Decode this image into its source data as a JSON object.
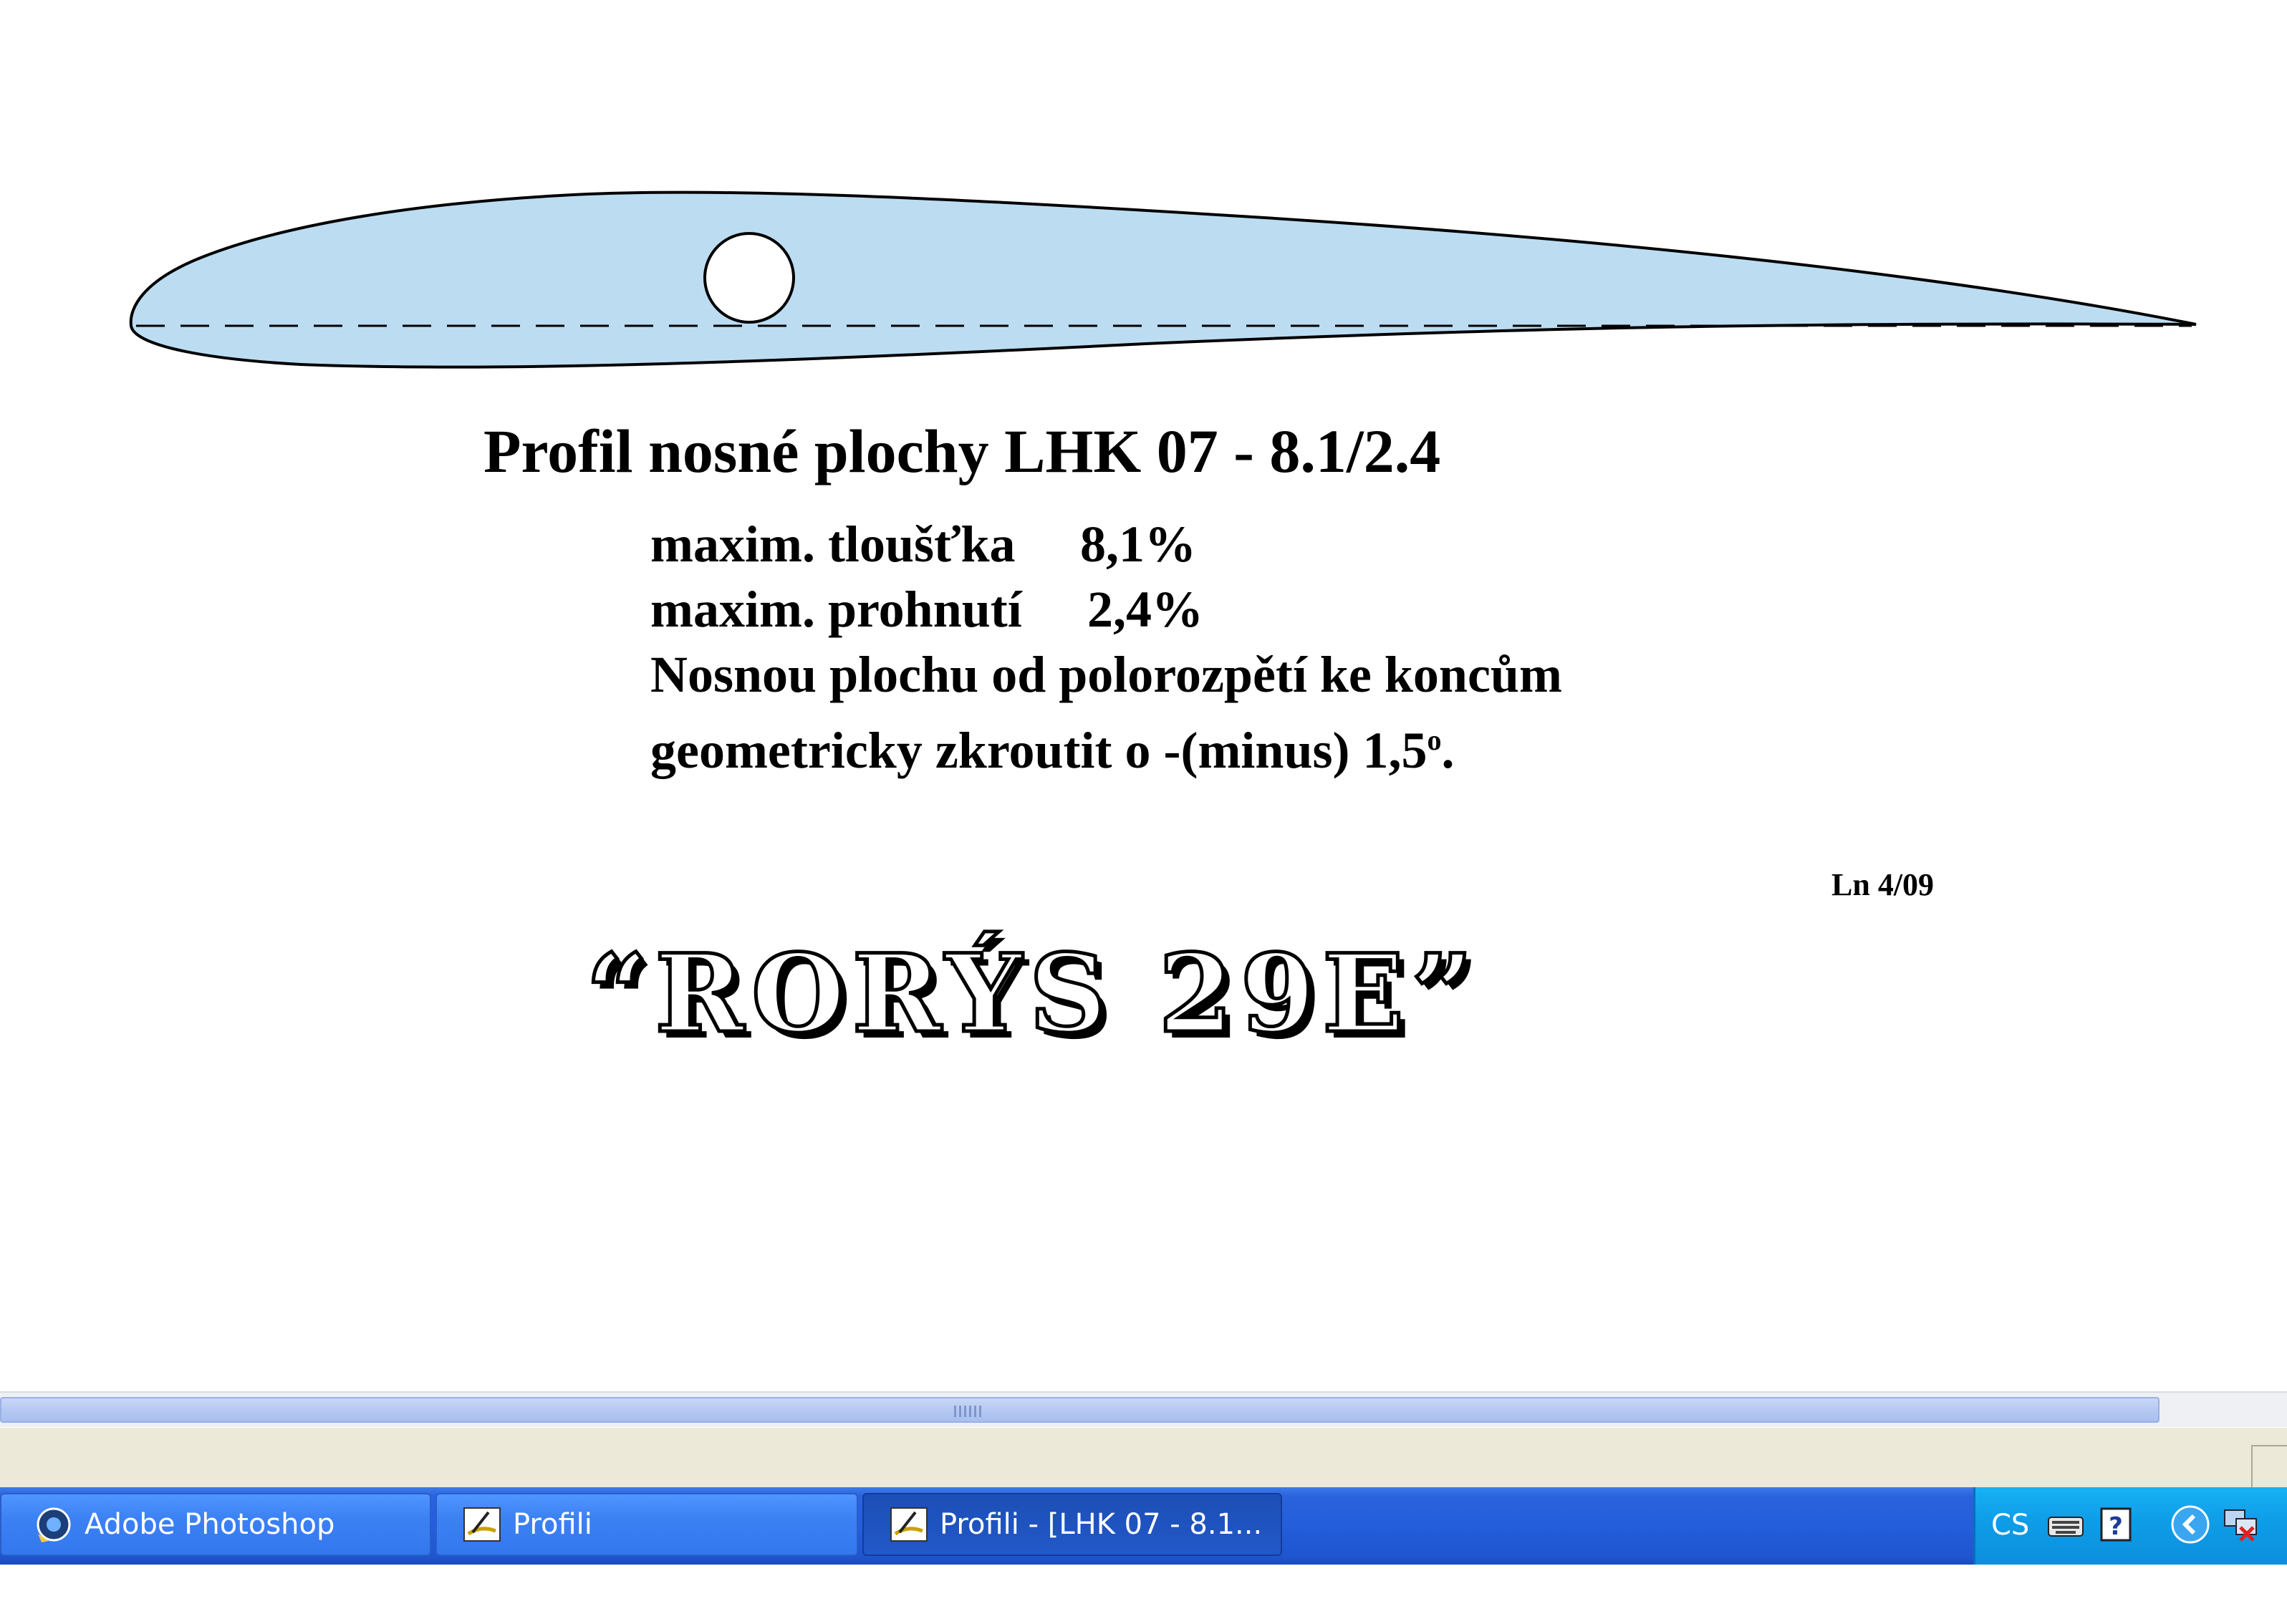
{
  "document": {
    "profile_title": "Profil nosné plochy  LHK 07 - 8.1/2.4",
    "specs": {
      "thickness_label": "maxim. tloušťka",
      "thickness_value": "8,1%",
      "camber_label": "maxim. prohnutí",
      "camber_value": "2,4%",
      "twist_line1": "Nosnou plochu od polorozpětí ke koncům",
      "twist_line2_prefix": "geometricky zkroutit o -(minus) 1,5",
      "twist_degree_mark": "o",
      "twist_suffix": "."
    },
    "author_date": "Ln  4/09",
    "model_name": "“RORÝS  29E”",
    "colors": {
      "airfoil_fill": "#bcdcf2",
      "airfoil_outline": "#000000"
    }
  },
  "taskbar": {
    "buttons": [
      {
        "label": "Adobe Photoshop",
        "icon": "photoshop-icon",
        "active": false
      },
      {
        "label": "Profili",
        "icon": "profili-app-icon",
        "active": false
      },
      {
        "label": "Profili - [LHK  07 - 8.1...",
        "icon": "profili-app-icon",
        "active": true
      }
    ],
    "tray": {
      "language": "CS",
      "icons": [
        "keyboard-icon",
        "help-icon",
        "show-hidden-icons-chevron",
        "network-disconnected-icon"
      ]
    }
  }
}
